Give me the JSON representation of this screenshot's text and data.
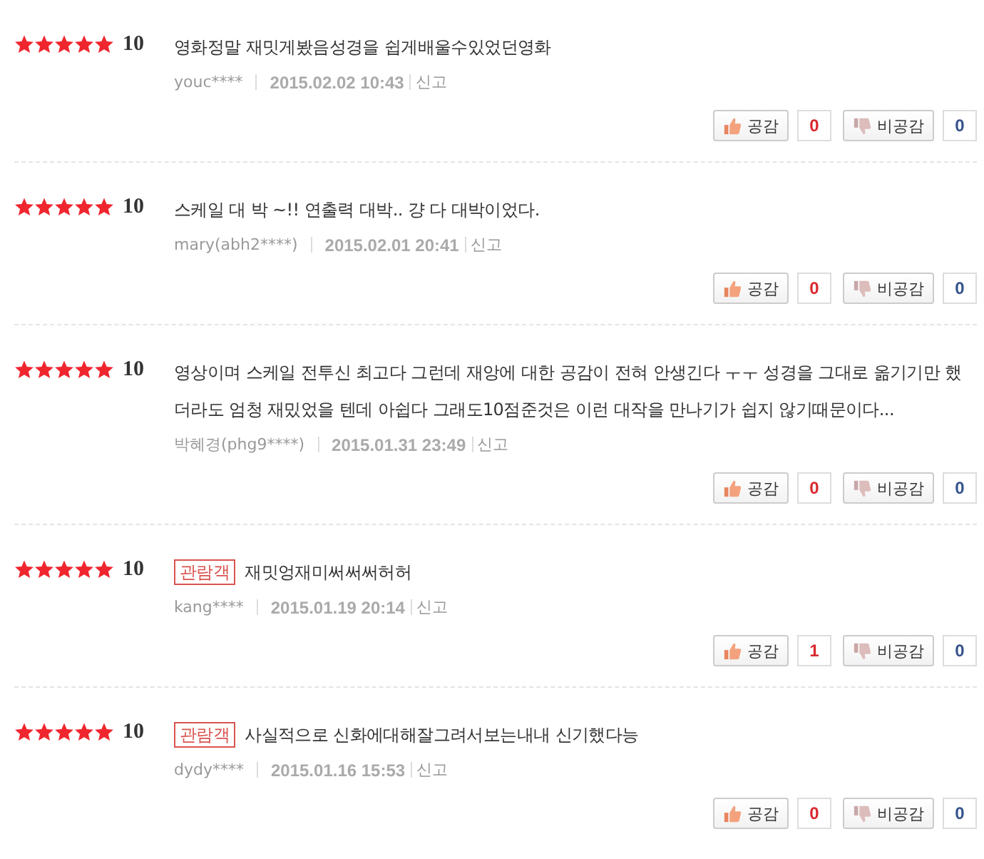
{
  "reviews": [
    {
      "stars": 5,
      "score": "10",
      "text": "영화정말 재밋게봤음성경을 쉽게배울수있었던영화",
      "user": "youc****",
      "date": "2015.02.02 10:43",
      "report": "신고",
      "like_label": "공감",
      "likes": "0",
      "dislike_label": "비공감",
      "dislikes": "0"
    },
    {
      "stars": 5,
      "score": "10",
      "text": "스케일 대 박 ~!! 연출력 대박.. 걍 다 대박이었다.",
      "user": "mary(abh2****)",
      "date": "2015.02.01 20:41",
      "report": "신고",
      "like_label": "공감",
      "likes": "0",
      "dislike_label": "비공감",
      "dislikes": "0"
    },
    {
      "stars": 5,
      "score": "10",
      "text": "영상이며 스케일 전투신 최고다 그런데 재앙에 대한 공감이 전혀 안생긴다 ㅜㅜ 성경을 그대로 옮기기만 했더라도 엄청 재밌었을 텐데 아쉽다 그래도10점준것은 이런 대작을 만나기가 쉽지 않기때문이다...",
      "user": "박혜경(phg9****)",
      "date": "2015.01.31 23:49",
      "report": "신고",
      "like_label": "공감",
      "likes": "0",
      "dislike_label": "비공감",
      "dislikes": "0"
    },
    {
      "stars": 5,
      "score": "10",
      "badge": "관람객",
      "text": "재밋엉재미써써써허허",
      "user": "kang****",
      "date": "2015.01.19 20:14",
      "report": "신고",
      "like_label": "공감",
      "likes": "1",
      "dislike_label": "비공감",
      "dislikes": "0"
    },
    {
      "stars": 5,
      "score": "10",
      "badge": "관람객",
      "text": "사실적으로 신화에대해잘그려서보는내내 신기했다능",
      "user": "dydy****",
      "date": "2015.01.16 15:53",
      "report": "신고",
      "like_label": "공감",
      "likes": "0",
      "dislike_label": "비공감",
      "dislikes": "0"
    }
  ]
}
